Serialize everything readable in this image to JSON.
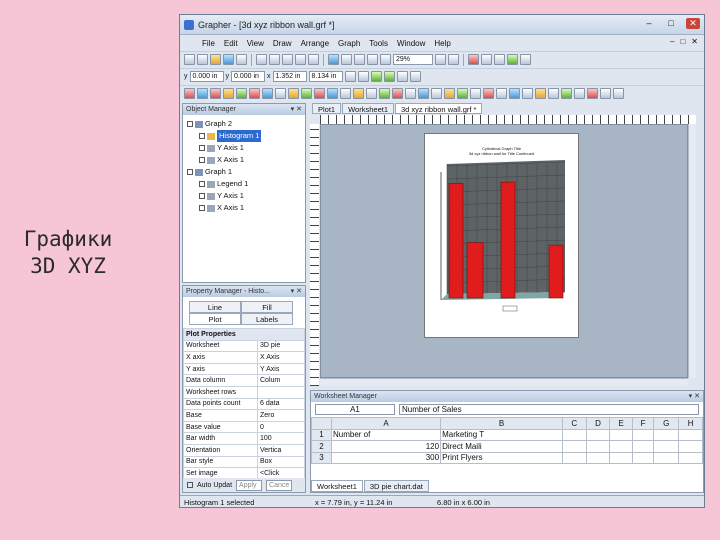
{
  "caption": {
    "line1": "Графики",
    "line2": "3D XYZ"
  },
  "window": {
    "title": "Grapher - [3d xyz ribbon wall.grf *]",
    "min": "–",
    "max": "□",
    "close": "✕"
  },
  "menu": [
    "File",
    "Edit",
    "View",
    "Draw",
    "Arrange",
    "Graph",
    "Tools",
    "Window",
    "Help"
  ],
  "toolbar": {
    "zoom": "29%",
    "x_label": "x",
    "x_value": "0.000 in",
    "y_label": "y",
    "y_value": "0.000 in",
    "w_value": "1.352 in",
    "h_value": "8.134 in"
  },
  "object_manager": {
    "title": "Object Manager",
    "items": [
      {
        "label": "Graph 2",
        "level": 0,
        "selected": false
      },
      {
        "label": "Histogram 1",
        "level": 1,
        "selected": true
      },
      {
        "label": "Y Axis 1",
        "level": 1,
        "selected": false
      },
      {
        "label": "X Axis 1",
        "level": 1,
        "selected": false
      },
      {
        "label": "Graph 1",
        "level": 0,
        "selected": false
      },
      {
        "label": "Legend 1",
        "level": 1,
        "selected": false
      },
      {
        "label": "Y Axis 1",
        "level": 1,
        "selected": false
      },
      {
        "label": "X Axis 1",
        "level": 1,
        "selected": false
      }
    ]
  },
  "property_manager": {
    "title": "Property Manager - Histo...",
    "tabs": [
      "Line",
      "Fill",
      "Plot",
      "Labels"
    ],
    "section": "Plot Properties",
    "rows": [
      {
        "k": "Worksheet",
        "v": "3D pie"
      },
      {
        "k": "X axis",
        "v": "X Axis"
      },
      {
        "k": "Y axis",
        "v": "Y Axis"
      },
      {
        "k": "Data column",
        "v": "Colum"
      },
      {
        "k": "Worksheet rows",
        "v": ""
      },
      {
        "k": "Data points count",
        "v": "6 data"
      },
      {
        "k": "Base",
        "v": "Zero"
      },
      {
        "k": "Base value",
        "v": "0"
      },
      {
        "k": "Bar width",
        "v": "100"
      },
      {
        "k": "Orientation",
        "v": "Vertica"
      },
      {
        "k": "Bar style",
        "v": "Box"
      },
      {
        "k": "Set image",
        "v": "<Click"
      }
    ],
    "auto_update": "Auto Updat",
    "apply": "Apply",
    "cancel": "Cance"
  },
  "doc_tabs": [
    "Plot1",
    "Worksheet1",
    "3d xyz ribbon wall.grf *"
  ],
  "chart": {
    "title": "Cylindrical Graph Title",
    "subtitle": "3d xyz ribbon wall for Title Continued",
    "bar_color": "#e11c1c",
    "levels": [
      0.91,
      0.44,
      0.92,
      0.42
    ],
    "side_color": "#5e6466"
  },
  "worksheet_manager": {
    "title": "Worksheet Manager",
    "cell_ref": "A1",
    "cell_value": "Number of Sales",
    "columns": [
      "A",
      "B",
      "C",
      "D",
      "E",
      "F",
      "G",
      "H"
    ],
    "rows": [
      {
        "n": "1",
        "a": "Number of",
        "b": "Marketing T"
      },
      {
        "n": "2",
        "a": "120",
        "b": "Direct Maili"
      },
      {
        "n": "3",
        "a": "300",
        "b": "Print Flyers"
      }
    ],
    "tabs": [
      "Worksheet1",
      "3D pie chart.dat"
    ]
  },
  "status": {
    "left": "Histogram 1 selected",
    "coords": "x = 7.79 in, y = 11.24 in",
    "size": "6.80 in x 6.00 in"
  }
}
